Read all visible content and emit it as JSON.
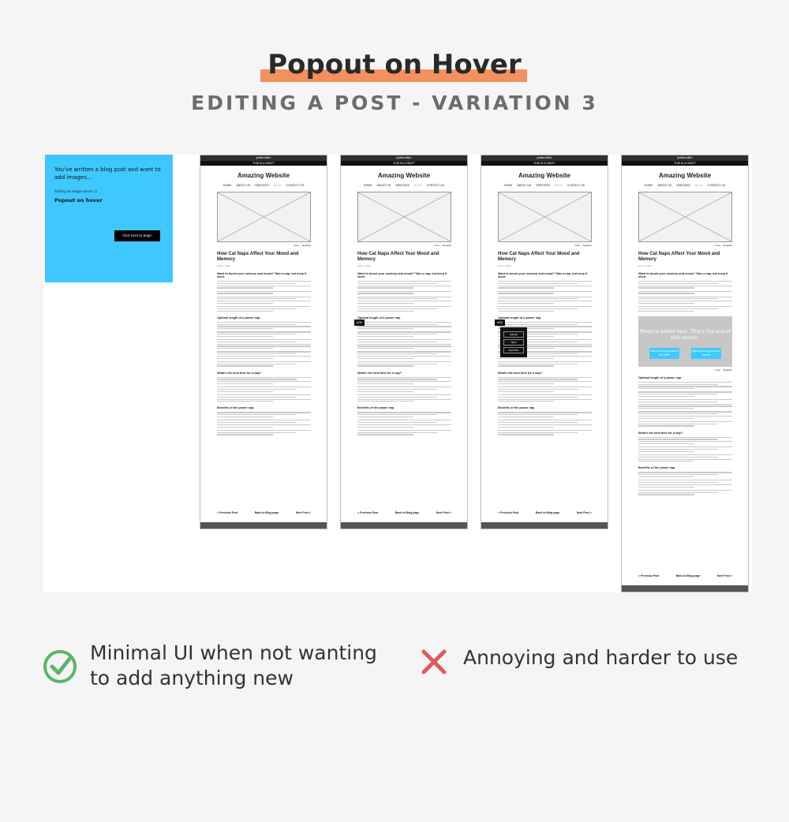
{
  "header": {
    "title": "Popout on Hover",
    "subtitle": "EDITING A POST - VARIATION 3"
  },
  "note": {
    "intro": "You've written a blog post and want to add images...",
    "small": "Adding an image version 3",
    "heading": "Popout on hover",
    "button": "Click here to begin"
  },
  "mockup": {
    "top_bar": "justfai editor",
    "draft_bar": "THIS IS A DRAFT",
    "site_title": "Amazing Website",
    "nav": [
      "HOME",
      "ABOUT US",
      "SERVICES",
      "BLOG",
      "CONTACT US"
    ],
    "caption_links": [
      "Crop",
      "Replace"
    ],
    "post_title": "How Cat Naps Affect Your Mood and Memory",
    "date": "Post 1, 2021",
    "headings": [
      "Want to boost your memory and mood? Take a nap, but keep it short",
      "Optimal length of a power nap",
      "What's the best time for a nap?",
      "Benefits of the power nap"
    ],
    "footer": [
      "< Previous Post",
      "Back to Blog page",
      "Next Post >"
    ],
    "add_label": "ADD",
    "menu": [
      "IMAGE",
      "TEXT",
      "BUTTON"
    ],
    "photo_text": "Photo is added here. That's the end of this version.",
    "photo_buttons": [
      "Click here to go back to the slide",
      "Click here to go to next version"
    ]
  },
  "legend": {
    "pro": "Minimal UI when not wanting to add anything new",
    "con": "Annoying and harder to use"
  },
  "colors": {
    "highlight": "#f3905f",
    "note_bg": "#3ec8ff",
    "check": "#5bb56c",
    "cross": "#e05a5a"
  }
}
